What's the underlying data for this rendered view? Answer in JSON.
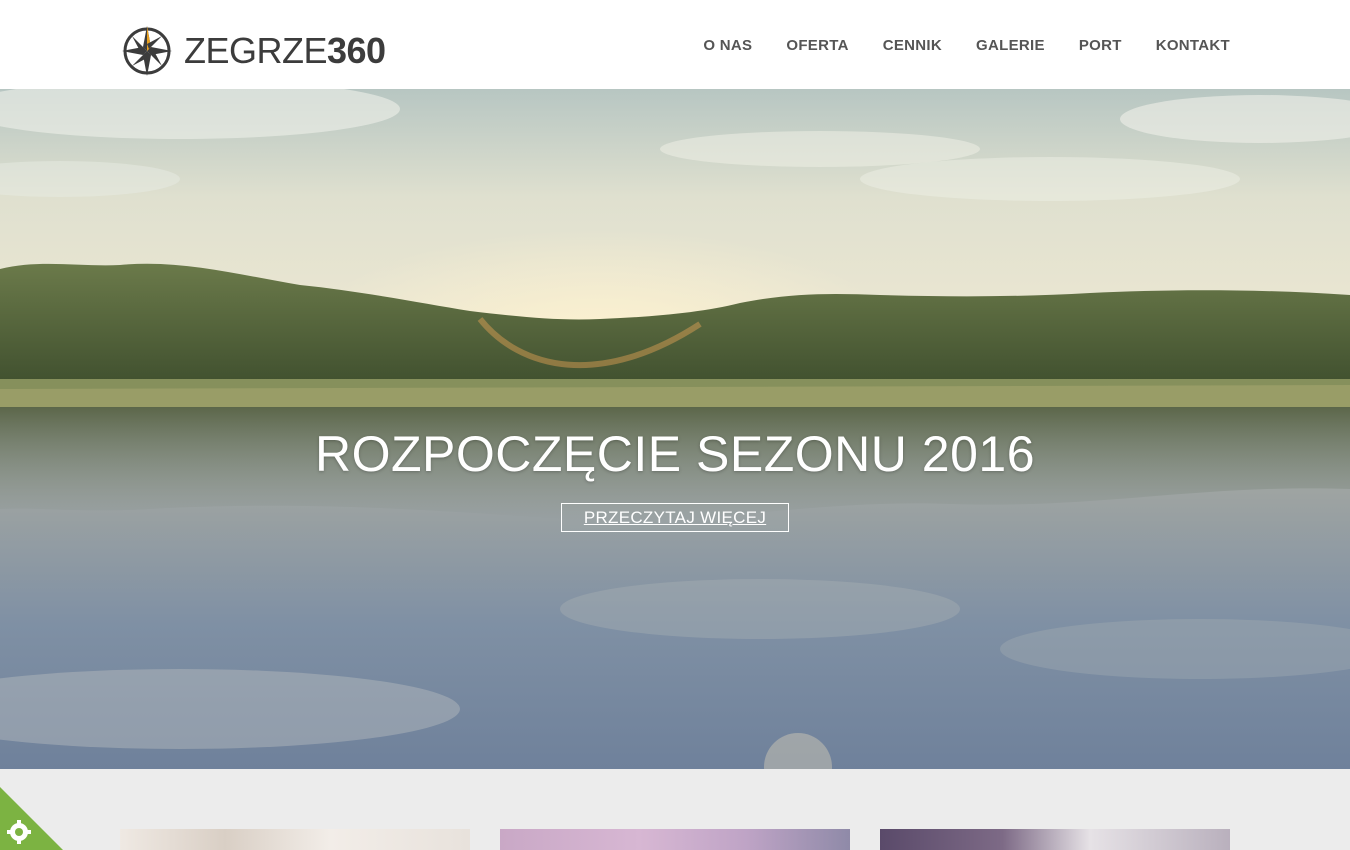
{
  "header": {
    "logo": {
      "text_light": "ZEGRZE",
      "text_bold": "360",
      "icon": "compass-rose-icon"
    },
    "nav": [
      {
        "label": "O NAS"
      },
      {
        "label": "OFERTA"
      },
      {
        "label": "CENNIK"
      },
      {
        "label": "GALERIE"
      },
      {
        "label": "PORT"
      },
      {
        "label": "KONTAKT"
      }
    ]
  },
  "hero": {
    "title": "ROZPOCZĘCIE SEZONU 2016",
    "button_label": "PRZECZYTAJ WIĘCEJ"
  },
  "cookie": {
    "icon": "cookie-gear-icon",
    "color": "#7cb342"
  },
  "colors": {
    "nav_text": "#555555",
    "logo_text": "#3c3c3c",
    "compass_accent": "#e8a020",
    "footer_bg": "#ececec"
  }
}
